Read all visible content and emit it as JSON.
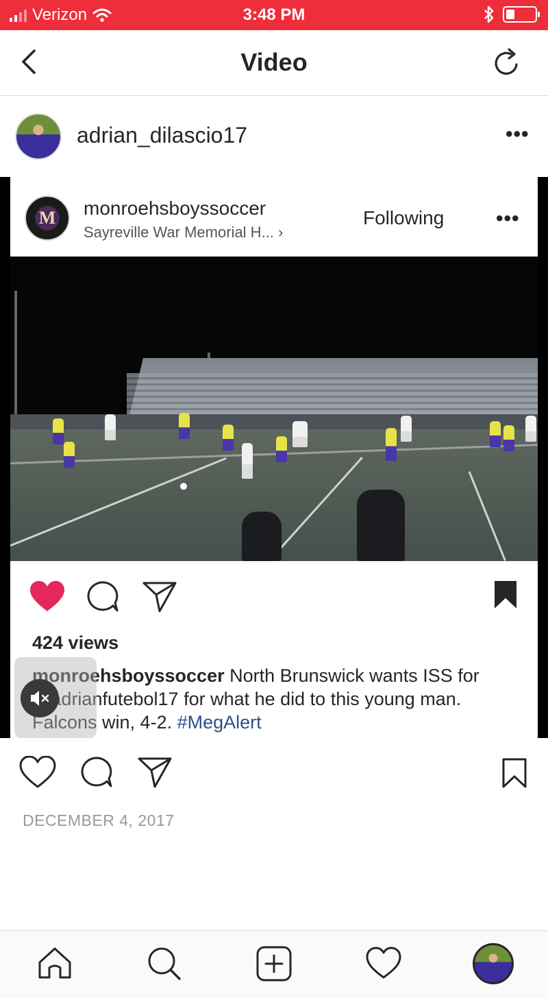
{
  "status_bar": {
    "carrier": "Verizon",
    "time": "3:48 PM",
    "battery_level": 0.3
  },
  "nav": {
    "title": "Video"
  },
  "post": {
    "username": "adrian_dilascio17",
    "date": "DECEMBER 4, 2017"
  },
  "embedded_post": {
    "username": "monroehsboyssoccer",
    "location": "Sayreville War Memorial H... ›",
    "follow_label": "Following",
    "views": "424 views",
    "caption_user": "monroehsboyssoccer",
    "caption_text_1": " North Brunswick wants ISS for @adrianfutebol17 for what he did to this young man. Falcons win, 4-2. ",
    "caption_hashtag": "#MegAlert",
    "avatar_letter": "M"
  },
  "colors": {
    "status_bar": "#ee2e3a",
    "like_active": "#e5285b",
    "text": "#262626",
    "muted": "#999999"
  },
  "icons": {
    "back": "chevron-left-icon",
    "refresh": "refresh-icon",
    "like": "heart-icon",
    "comment": "comment-icon",
    "share": "paper-plane-icon",
    "save": "bookmark-icon",
    "home": "home-icon",
    "search": "search-icon",
    "new_post": "plus-square-icon",
    "activity": "heart-icon"
  }
}
